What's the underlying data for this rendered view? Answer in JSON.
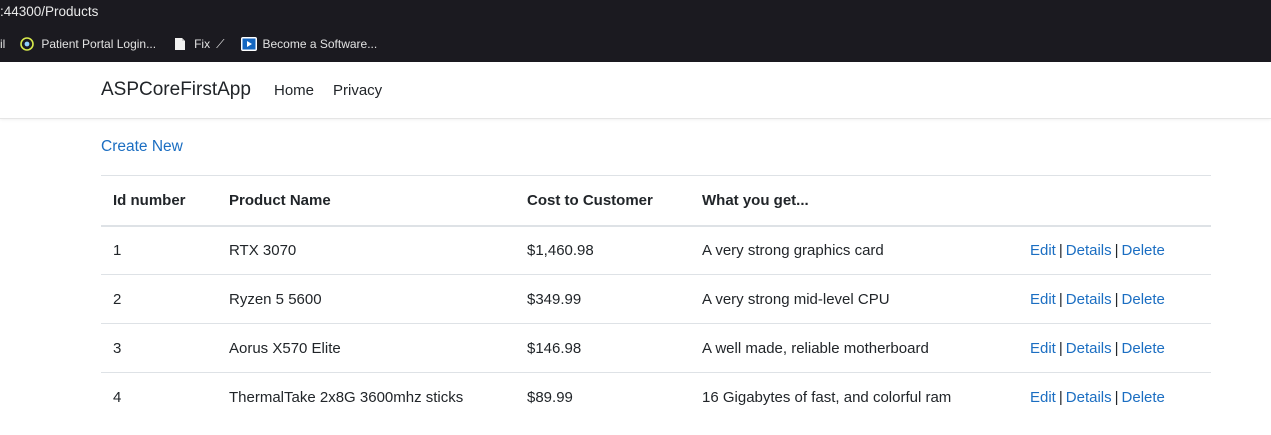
{
  "browser": {
    "url_text": ":44300/Products",
    "bookmarks": [
      {
        "label": "il",
        "icon": "truncated-bookmark"
      },
      {
        "label": "Patient Portal Login...",
        "icon": "portal-icon"
      },
      {
        "label": "Fix",
        "icon": "document-icon",
        "suffix": "⟋"
      },
      {
        "label": "Become a Software...",
        "icon": "video-play-icon"
      }
    ]
  },
  "nav": {
    "brand": "ASPCoreFirstApp",
    "links": [
      "Home",
      "Privacy"
    ]
  },
  "page": {
    "create_new": "Create New"
  },
  "table": {
    "headers": [
      "Id number",
      "Product Name",
      "Cost to Customer",
      "What you get..."
    ],
    "rows": [
      {
        "id": "1",
        "name": "RTX 3070",
        "cost": "$1,460.98",
        "desc": "A very strong graphics card"
      },
      {
        "id": "2",
        "name": "Ryzen 5 5600",
        "cost": "$349.99",
        "desc": "A very strong mid-level CPU"
      },
      {
        "id": "3",
        "name": "Aorus X570 Elite",
        "cost": "$146.98",
        "desc": "A well made, reliable motherboard"
      },
      {
        "id": "4",
        "name": "ThermalTake 2x8G 3600mhz sticks",
        "cost": "$89.99",
        "desc": "16 Gigabytes of fast, and colorful ram"
      }
    ],
    "actions": {
      "edit": "Edit",
      "details": "Details",
      "delete": "Delete",
      "separator": "|"
    }
  },
  "colors": {
    "browser_bg": "#1b1a20",
    "link": "#1b6ec2",
    "text": "#212529",
    "divider": "#dee2e6"
  }
}
